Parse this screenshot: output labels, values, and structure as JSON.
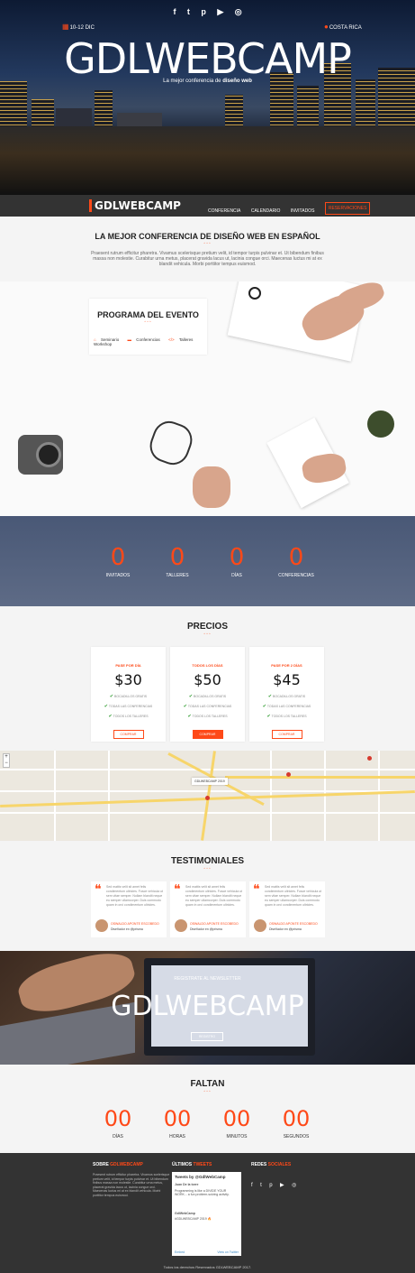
{
  "hero": {
    "social_icons": [
      "facebook-icon",
      "twitter-icon",
      "pinterest-icon",
      "youtube-icon",
      "instagram-icon"
    ],
    "social_glyphs": [
      "f",
      "t",
      "p",
      "▶",
      "◎"
    ],
    "date": "10-12 DIC",
    "location": "COSTA RICA",
    "title": "GDLWEBCAMP",
    "subtitle_pre": "La mejor conferencia de ",
    "subtitle_bold": "diseño web"
  },
  "nav": {
    "logo": "GDLWEBCAMP",
    "items": [
      "CONFERENCIA",
      "CALENDARIO",
      "INVITADOS"
    ],
    "cta": "RESERVACIONES"
  },
  "intro": {
    "title": "LA MEJOR CONFERENCIA DE DISEÑO WEB EN ESPAÑOL",
    "text": "Praesent rutrum efficitur pharetra. Vivamus scelerisque pretium velit, id tempor turpis pulvinar et. Ut bibendum finibus massa non molestie. Curabitur urna metus, placerat gravida lacus ut, lacinia congue orci. Maecenas luctus mi at ex blandit vehicula. Morbi porttitor tempus euismod."
  },
  "program": {
    "title": "PROGRAMA DEL EVENTO",
    "tabs": [
      "Seminario",
      "Conferencias",
      "Talleres",
      "Workshop"
    ]
  },
  "counters": [
    {
      "value": "0",
      "label": "INVITADOS"
    },
    {
      "value": "0",
      "label": "TALLERES"
    },
    {
      "value": "0",
      "label": "DÍAS"
    },
    {
      "value": "0",
      "label": "CONFERENCIAS"
    }
  ],
  "prices": {
    "title": "PRECIOS",
    "cards": [
      {
        "tier": "PASE POR DÍA",
        "price": "$30",
        "features": [
          "BOCADILLOS GRATIS",
          "TODAS LAS CONFERENCIAS",
          "TODOS LOS TALLERES"
        ],
        "button": "COMPRAR"
      },
      {
        "tier": "TODOS LOS DÍAS",
        "price": "$50",
        "features": [
          "BOCADILLOS GRATIS",
          "TODAS LAS CONFERENCIAS",
          "TODOS LOS TALLERES"
        ],
        "button": "COMPRAR"
      },
      {
        "tier": "PASE POR 2 DÍAS",
        "price": "$45",
        "features": [
          "BOCADILLOS GRATIS",
          "TODAS LAS CONFERENCIAS",
          "TODOS LOS TALLERES"
        ],
        "button": "COMPRAR"
      }
    ]
  },
  "map": {
    "zoom_in": "+",
    "zoom_out": "−",
    "label": "GDLWEBCAMP 2019"
  },
  "testimonials": {
    "title": "TESTIMONIALES",
    "items": [
      {
        "text": "Sed mattis velit sit amet felis condimentum ultricies. Fusce vehicula ut sem vitae semper. Nullam blandit neque eu semper ullamcorper. Duis commodo quam in orci condimentum ultricies.",
        "name": "OSWALDO APONTE ESCOBEDO",
        "role": "Diseñador en @prisma"
      },
      {
        "text": "Sed mattis velit sit amet felis condimentum ultricies. Fusce vehicula ut sem vitae semper. Nullam blandit neque eu semper ullamcorper. Duis commodo quam in orci condimentum ultricies.",
        "name": "OSWALDO APONTE ESCOBEDO",
        "role": "Diseñador en @prisma"
      },
      {
        "text": "Sed mattis velit sit amet felis condimentum ultricies. Fusce vehicula ut sem vitae semper. Nullam blandit neque eu semper ullamcorper. Duis commodo quam in orci condimentum ultricies.",
        "name": "OSWALDO APONTE ESCOBEDO",
        "role": "Diseñador en @prisma"
      }
    ]
  },
  "cta": {
    "small": "REGISTRATE AL NEWSLETTER",
    "title": "GDLWEBCAMP",
    "button": "REGISTRO"
  },
  "countdown": {
    "title": "FALTAN",
    "items": [
      {
        "value": "00",
        "label": "DÍAS"
      },
      {
        "value": "00",
        "label": "HORAS"
      },
      {
        "value": "00",
        "label": "MINUTOS"
      },
      {
        "value": "00",
        "label": "SEGUNDOS"
      }
    ]
  },
  "footer": {
    "about_title_pre": "SOBRE ",
    "about_title_acc": "GDLWEBCAMP",
    "about_text": "Praesent rutrum efficitur pharetra. Vivamus scelerisque pretium velit, id tempor turpis pulvinar et. Ut bibendum finibus massa non molestie. Curabitur urna metus, placerat gravida lacus ut, lacinia congue orci. Maecenas luctus mi at ex blandit vehicula. Morbi porttitor tempus euismod.",
    "tweets_title_pre": "ÚLTIMOS ",
    "tweets_title_acc": "TWEETS",
    "tweets_header": "Tweets by @GdlWebCamp",
    "tweet_lines": [
      "Juan De la torre",
      "Programming is like a DIVIDE YOUR WORK... a fun problem-solving activity.",
      "GdlWebCamp",
      "#GDLWEBCAMP 2019 🔥"
    ],
    "tweet_embed": "Embed",
    "tweet_view": "View on Twitter",
    "social_title_pre": "REDES ",
    "social_title_acc": "SOCIALES",
    "social_glyphs": [
      "f",
      "t",
      "p",
      "▶",
      "◎"
    ],
    "copyright": "Todos los derechos Reservados GDLWEBCAMP 2017."
  },
  "colors": {
    "accent": "#fe4918",
    "dark": "#333333",
    "light": "#f4f4f4"
  }
}
